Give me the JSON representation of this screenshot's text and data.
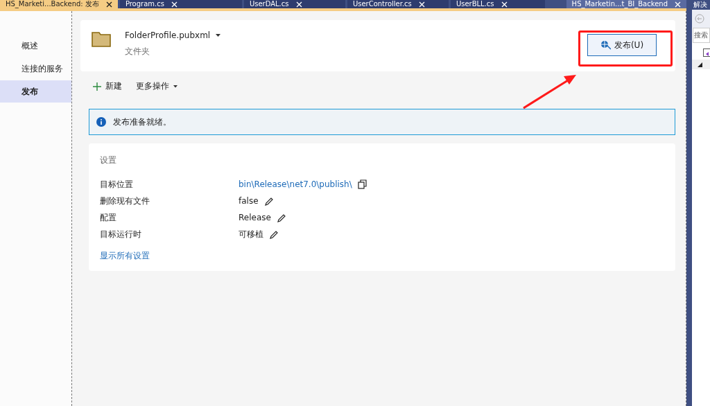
{
  "tabs": [
    {
      "label": "HS_Marketi...Backend: 发布",
      "selected": true
    },
    {
      "label": "Program.cs",
      "selected": false
    },
    {
      "label": "UserDAL.cs",
      "selected": false
    },
    {
      "label": "UserController.cs",
      "selected": false
    },
    {
      "label": "UserBLL.cs",
      "selected": false
    },
    {
      "label": "HS_Marketin...t_BI_Backend",
      "selected": false
    }
  ],
  "nav": {
    "items": [
      {
        "label": "概述",
        "selected": false
      },
      {
        "label": "连接的服务",
        "selected": false
      },
      {
        "label": "发布",
        "selected": true
      }
    ]
  },
  "profile": {
    "name": "FolderProfile.pubxml",
    "type": "文件夹",
    "publish_button": "发布(U)"
  },
  "toolbar": [
    {
      "label": "新建",
      "kind": "new"
    },
    {
      "label": "更多操作",
      "kind": "menu"
    }
  ],
  "info": "发布准备就绪。",
  "settings": {
    "title": "设置",
    "rows": [
      {
        "label": "目标位置",
        "value": "bin\\Release\\net7.0\\publish\\",
        "kind": "link"
      },
      {
        "label": "删除现有文件",
        "value": "false",
        "kind": "editable"
      },
      {
        "label": "配置",
        "value": "Release",
        "kind": "editable"
      },
      {
        "label": "目标运行时",
        "value": "可移植",
        "kind": "editable"
      }
    ],
    "show_all": "显示所有设置"
  },
  "solution_panel": {
    "title": "解决",
    "search_placeholder": "搜索"
  }
}
